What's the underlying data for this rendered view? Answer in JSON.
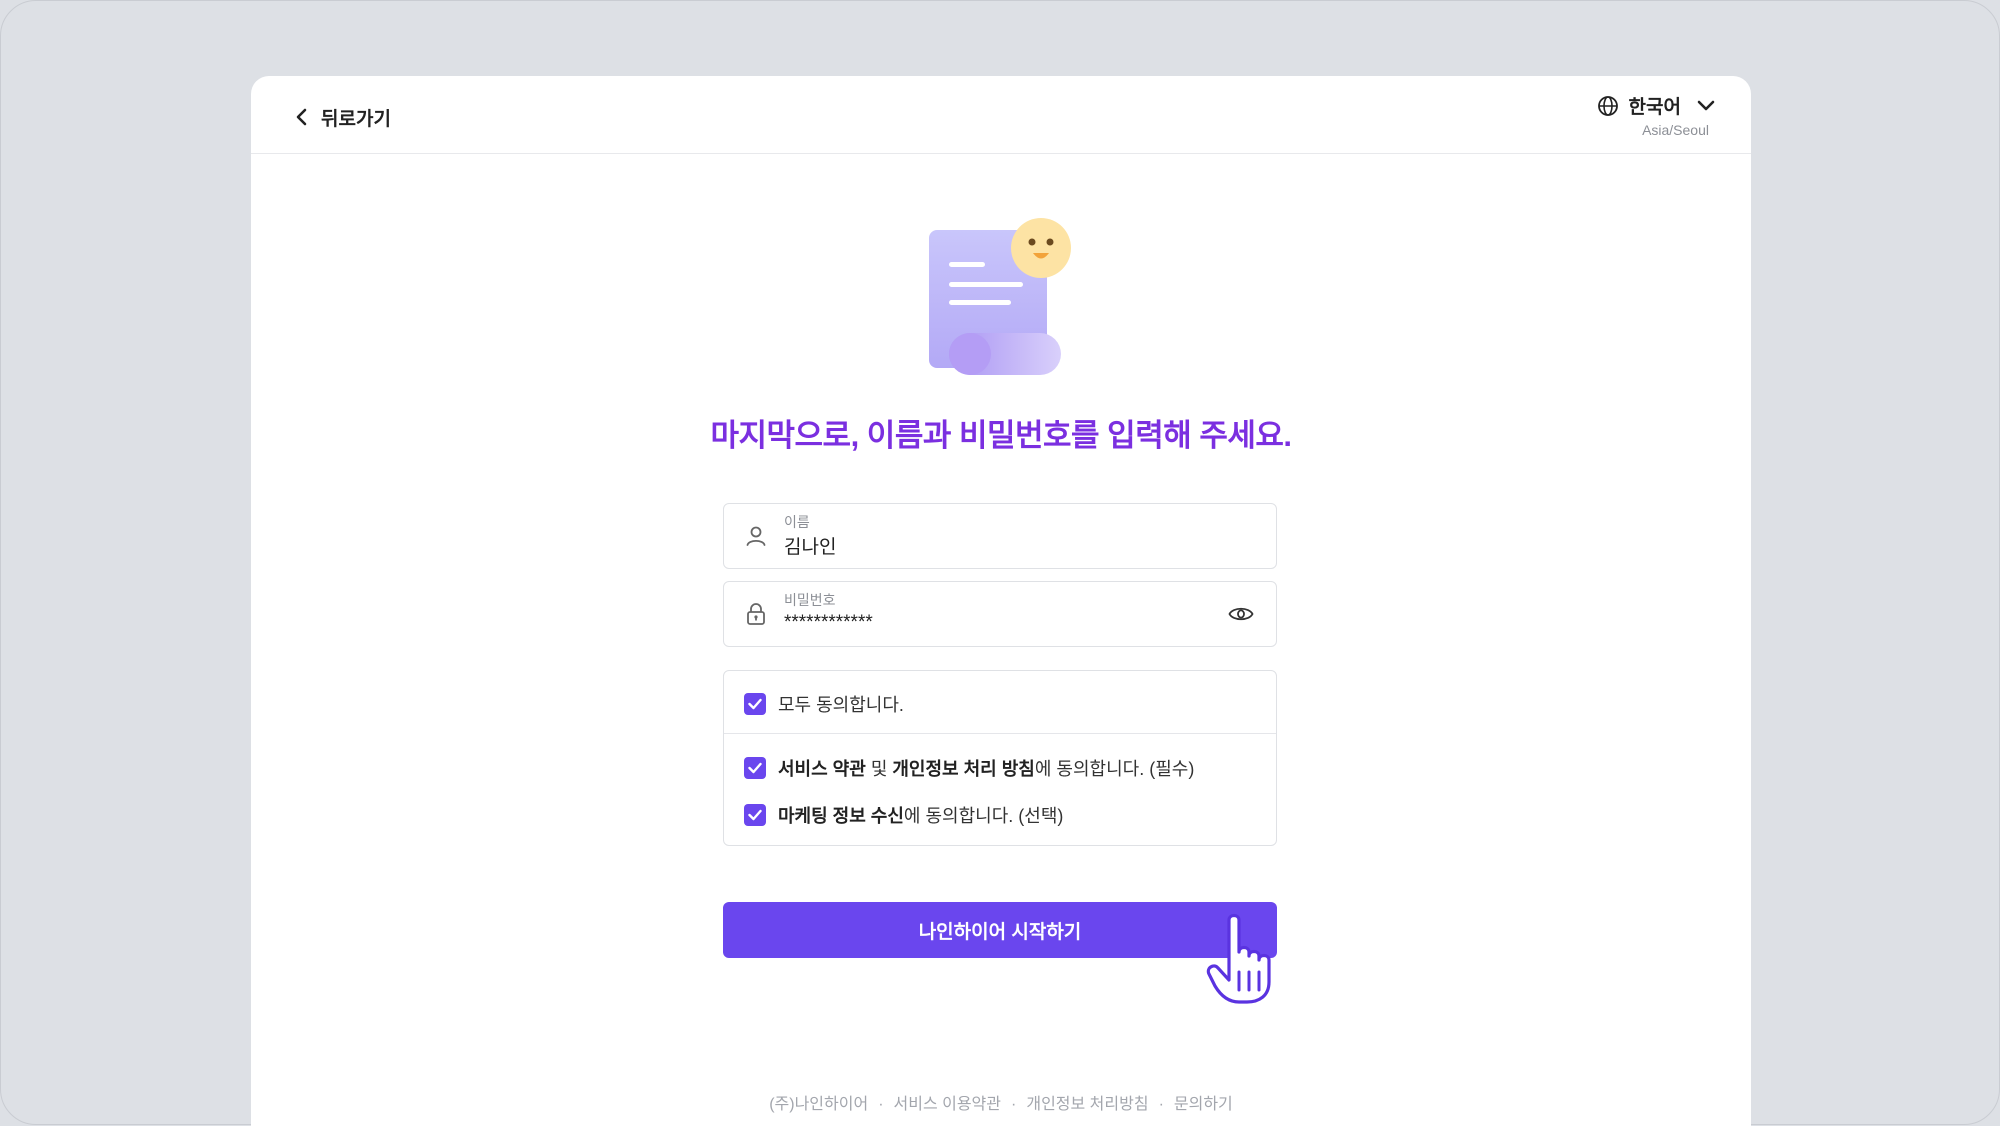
{
  "header": {
    "back_label": "뒤로가기",
    "language_label": "한국어",
    "timezone": "Asia/Seoul"
  },
  "main": {
    "heading": "마지막으로, 이름과 비밀번호를 입력해 주세요.",
    "name_field": {
      "label": "이름",
      "value": "김나인",
      "icon": "user-icon"
    },
    "password_field": {
      "label": "비밀번호",
      "value": "************",
      "icon": "lock-icon",
      "toggle_icon": "eye-icon"
    },
    "agree_all": {
      "label": "모두 동의합니다.",
      "checked": true
    },
    "agree_terms": {
      "bold1": "서비스 약관",
      "mid": " 및 ",
      "bold2": "개인정보 처리 방침",
      "rest": "에 동의합니다. (필수)",
      "checked": true
    },
    "agree_marketing": {
      "bold": "마케팅 정보 수신",
      "rest": "에 동의합니다. (선택)",
      "checked": true
    },
    "submit_label": "나인하이어 시작하기"
  },
  "footer": {
    "links": [
      "(주)나인하이어",
      "서비스 이용약관",
      "개인정보 처리방침",
      "문의하기"
    ],
    "separator": "·"
  },
  "colors": {
    "accent": "#6a46ee",
    "heading": "#7b2fe0",
    "background": "#dde0e5"
  }
}
